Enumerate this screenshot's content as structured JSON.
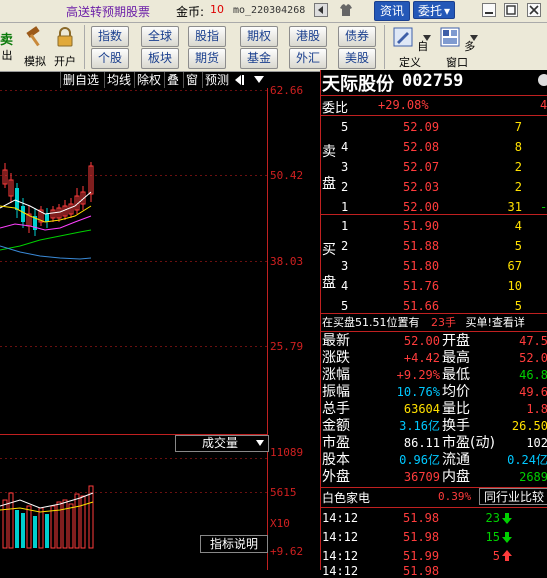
{
  "topbar": {
    "promo": "高送转预期股票",
    "gold_label": "金币:",
    "gold_value": "10",
    "user": "mo_220304268",
    "btn_news": "资讯",
    "btn_trade": "委托",
    "trade_arrow": "▾"
  },
  "toolbar": {
    "tools": [
      {
        "label": "出",
        "icon": "sell-icon"
      },
      {
        "label": "模拟",
        "icon": "hammer-icon"
      },
      {
        "label": "开户",
        "icon": "lock-icon"
      }
    ],
    "partial_top": "卖",
    "markets_row1": [
      "指数",
      "全球",
      "股指",
      "期权",
      "港股",
      "债券"
    ],
    "markets_row2": [
      "个股",
      "板块",
      "期货",
      "基金",
      "外汇",
      "美股"
    ],
    "custom_label": "自定义",
    "multi_label": "多窗口"
  },
  "chart": {
    "tabs": [
      "删自选",
      "均线",
      "除权",
      "叠",
      "窗",
      "预测"
    ],
    "price_axis": [
      "62.66",
      "50.42",
      "38.03",
      "25.79"
    ],
    "volume_axis": [
      "11089",
      "5615",
      "X10"
    ],
    "volume_label": "成交量",
    "indicator_label": "指标说明",
    "bottom_change": "+9.62"
  },
  "quote": {
    "name": "天际股份",
    "code": "002759",
    "weibi_label": "委比",
    "weibi_value": "+29.08%",
    "weibi_extra": "4",
    "sell_label": [
      "卖",
      "盘"
    ],
    "buy_label": [
      "买",
      "盘"
    ],
    "sell": [
      {
        "level": "5",
        "price": "52.09",
        "vol": "7",
        "extra": ""
      },
      {
        "level": "4",
        "price": "52.08",
        "vol": "8",
        "extra": ""
      },
      {
        "level": "3",
        "price": "52.07",
        "vol": "2",
        "extra": ""
      },
      {
        "level": "2",
        "price": "52.03",
        "vol": "2",
        "extra": ""
      },
      {
        "level": "1",
        "price": "52.00",
        "vol": "31",
        "extra": "-"
      }
    ],
    "buy": [
      {
        "level": "1",
        "price": "51.90",
        "vol": "4"
      },
      {
        "level": "2",
        "price": "51.88",
        "vol": "5"
      },
      {
        "level": "3",
        "price": "51.80",
        "vol": "67"
      },
      {
        "level": "4",
        "price": "51.76",
        "vol": "10"
      },
      {
        "level": "5",
        "price": "51.66",
        "vol": "5"
      }
    ],
    "status_text": "在买盘51.51位置有",
    "status_qty": "23手",
    "status_action": "买单!",
    "status_link": "查看详",
    "stats": [
      {
        "l1": "最新",
        "v1": "52.00",
        "c1": "red",
        "l2": "开盘",
        "v2": "47.5",
        "c2": "red"
      },
      {
        "l1": "涨跌",
        "v1": "+4.42",
        "c1": "red",
        "l2": "最高",
        "v2": "52.0",
        "c2": "red"
      },
      {
        "l1": "涨幅",
        "v1": "+9.29%",
        "c1": "red",
        "l2": "最低",
        "v2": "46.8",
        "c2": "green"
      },
      {
        "l1": "振幅",
        "v1": "10.76%",
        "c1": "cyan",
        "l2": "均价",
        "v2": "49.6",
        "c2": "red"
      },
      {
        "l1": "总手",
        "v1": "63604",
        "c1": "yellow",
        "l2": "量比",
        "v2": "1.8",
        "c2": "red"
      },
      {
        "l1": "金额",
        "v1": "3.16亿",
        "c1": "cyan",
        "l2": "换手",
        "v2": "26.50",
        "c2": "yellow"
      },
      {
        "l1": "市盈",
        "v1": "86.11",
        "c1": "white",
        "l2": "市盈(动)",
        "v2": "102",
        "c2": "white"
      },
      {
        "l1": "股本",
        "v1": "0.96亿",
        "c1": "cyan",
        "l2": "流通",
        "v2": "0.24亿",
        "c2": "cyan"
      },
      {
        "l1": "外盘",
        "v1": "36709",
        "c1": "red",
        "l2": "内盘",
        "v2": "2689",
        "c2": "green"
      }
    ],
    "sector_name": "白色家电",
    "sector_change": "0.39%",
    "sector_btn": "同行业比较",
    "ticks": [
      {
        "time": "14:12",
        "price": "51.98",
        "vol": "23",
        "dir": "down"
      },
      {
        "time": "14:12",
        "price": "51.98",
        "vol": "15",
        "dir": "down"
      },
      {
        "time": "14:12",
        "price": "51.99",
        "vol": "5",
        "dir": "up"
      }
    ],
    "tick_partial": {
      "time": "14:12",
      "price": "51.98"
    }
  }
}
